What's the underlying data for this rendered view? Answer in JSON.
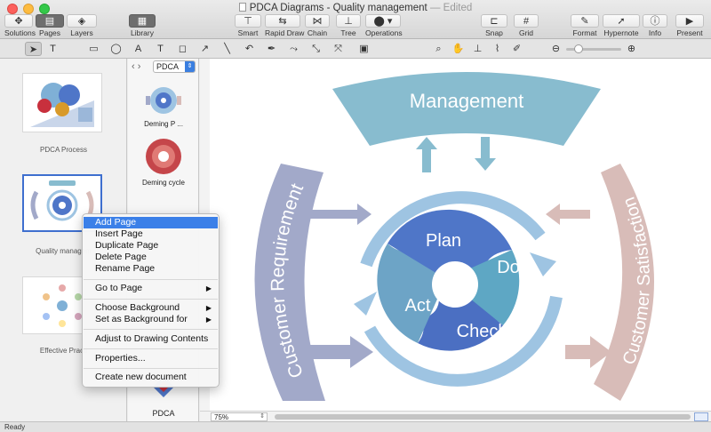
{
  "window": {
    "title": "PDCA Diagrams - Quality management",
    "edited": "— Edited"
  },
  "toolbar": {
    "solutions": "Solutions",
    "pages": "Pages",
    "layers": "Layers",
    "library": "Library",
    "smart": "Smart",
    "rapid_draw": "Rapid Draw",
    "chain": "Chain",
    "tree": "Tree",
    "operations": "Operations",
    "snap": "Snap",
    "grid": "Grid",
    "format": "Format",
    "hypernote": "Hypernote",
    "info": "Info",
    "present": "Present"
  },
  "pages_panel": {
    "pages": [
      {
        "label": "PDCA Process"
      },
      {
        "label": "Quality managem"
      },
      {
        "label": "Effective Practi"
      }
    ]
  },
  "library_panel": {
    "selected_library": "PDCA",
    "items": [
      {
        "label": "Deming P ..."
      },
      {
        "label": "Deming cycle"
      },
      {
        "label": "PDCA"
      }
    ]
  },
  "context_menu": {
    "items": [
      "Add Page",
      "Insert Page",
      "Duplicate Page",
      "Delete Page",
      "Rename Page",
      "Go to Page",
      "Choose Background",
      "Set as Background for",
      "Adjust to Drawing Contents",
      "Properties...",
      "Create new document"
    ]
  },
  "diagram": {
    "top_label": "Management",
    "left_label": "Customer Requirement",
    "right_label": "Customer Satisfaction",
    "segments": [
      "Plan",
      "Do",
      "Check",
      "Act"
    ],
    "colors": {
      "management": "#88bccf",
      "requirement": "#a2a9c9",
      "satisfaction": "#d8bcb8",
      "ring": "#9ec4e2",
      "plan": "#4f76c8",
      "do": "#5ea7c4",
      "check": "#4b6fc2",
      "act": "#6da4c6"
    }
  },
  "zoom": {
    "value": "75%"
  },
  "status": {
    "text": "Ready"
  }
}
